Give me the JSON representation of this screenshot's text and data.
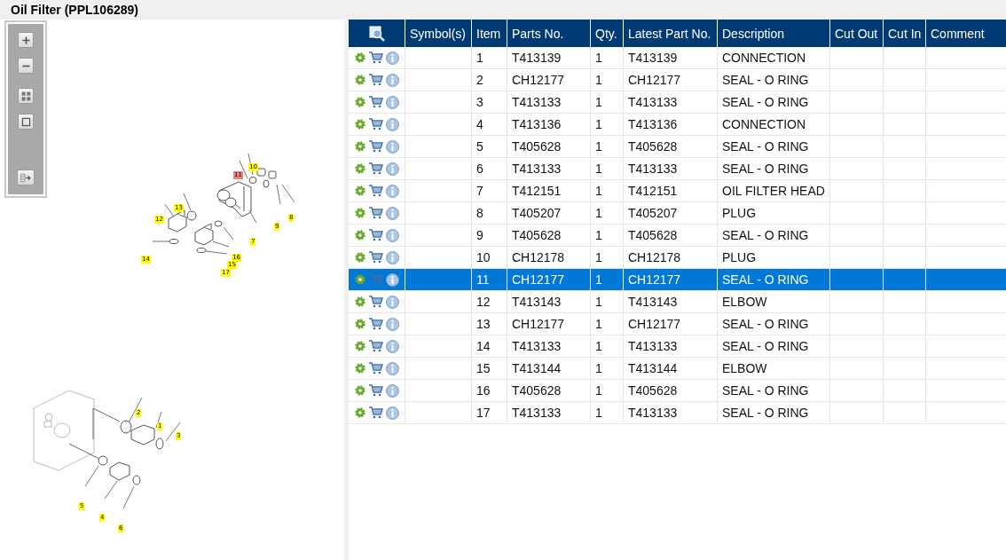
{
  "title": "Oil Filter (PPL106289)",
  "columns": [
    "Symbol(s)",
    "Item",
    "Parts No.",
    "Qty.",
    "Latest Part No.",
    "Description",
    "Cut Out",
    "Cut In",
    "Comment"
  ],
  "rows": [
    {
      "item": "1",
      "part_no": "T413139",
      "qty": "1",
      "latest_part_no": "T413139",
      "description": "CONNECTION",
      "selected": false
    },
    {
      "item": "2",
      "part_no": "CH12177",
      "qty": "1",
      "latest_part_no": "CH12177",
      "description": "SEAL - O RING",
      "selected": false
    },
    {
      "item": "3",
      "part_no": "T413133",
      "qty": "1",
      "latest_part_no": "T413133",
      "description": "SEAL - O RING",
      "selected": false
    },
    {
      "item": "4",
      "part_no": "T413136",
      "qty": "1",
      "latest_part_no": "T413136",
      "description": "CONNECTION",
      "selected": false
    },
    {
      "item": "5",
      "part_no": "T405628",
      "qty": "1",
      "latest_part_no": "T405628",
      "description": "SEAL - O RING",
      "selected": false
    },
    {
      "item": "6",
      "part_no": "T413133",
      "qty": "1",
      "latest_part_no": "T413133",
      "description": "SEAL - O RING",
      "selected": false
    },
    {
      "item": "7",
      "part_no": "T412151",
      "qty": "1",
      "latest_part_no": "T412151",
      "description": "OIL FILTER HEAD",
      "selected": false
    },
    {
      "item": "8",
      "part_no": "T405207",
      "qty": "1",
      "latest_part_no": "T405207",
      "description": "PLUG",
      "selected": false
    },
    {
      "item": "9",
      "part_no": "T405628",
      "qty": "1",
      "latest_part_no": "T405628",
      "description": "SEAL - O RING",
      "selected": false
    },
    {
      "item": "10",
      "part_no": "CH12178",
      "qty": "1",
      "latest_part_no": "CH12178",
      "description": "PLUG",
      "selected": false
    },
    {
      "item": "11",
      "part_no": "CH12177",
      "qty": "1",
      "latest_part_no": "CH12177",
      "description": "SEAL - O RING",
      "selected": true
    },
    {
      "item": "12",
      "part_no": "T413143",
      "qty": "1",
      "latest_part_no": "T413143",
      "description": "ELBOW",
      "selected": false
    },
    {
      "item": "13",
      "part_no": "CH12177",
      "qty": "1",
      "latest_part_no": "CH12177",
      "description": "SEAL - O RING",
      "selected": false
    },
    {
      "item": "14",
      "part_no": "T413133",
      "qty": "1",
      "latest_part_no": "T413133",
      "description": "SEAL - O RING",
      "selected": false
    },
    {
      "item": "15",
      "part_no": "T413144",
      "qty": "1",
      "latest_part_no": "T413144",
      "description": "ELBOW",
      "selected": false
    },
    {
      "item": "16",
      "part_no": "T405628",
      "qty": "1",
      "latest_part_no": "T405628",
      "description": "SEAL - O RING",
      "selected": false
    },
    {
      "item": "17",
      "part_no": "T413133",
      "qty": "1",
      "latest_part_no": "T413133",
      "description": "SEAL - O RING",
      "selected": false
    }
  ],
  "callouts": [
    {
      "label": "10",
      "selected": false
    },
    {
      "label": "11",
      "selected": true
    },
    {
      "label": "13",
      "selected": false
    },
    {
      "label": "12",
      "selected": false
    },
    {
      "label": "8",
      "selected": false
    },
    {
      "label": "9",
      "selected": false
    },
    {
      "label": "7",
      "selected": false
    },
    {
      "label": "16",
      "selected": false
    },
    {
      "label": "15",
      "selected": false
    },
    {
      "label": "14",
      "selected": false
    },
    {
      "label": "17",
      "selected": false
    },
    {
      "label": "2",
      "selected": false
    },
    {
      "label": "1",
      "selected": false
    },
    {
      "label": "3",
      "selected": false
    },
    {
      "label": "5",
      "selected": false
    },
    {
      "label": "4",
      "selected": false
    },
    {
      "label": "6",
      "selected": false
    }
  ]
}
